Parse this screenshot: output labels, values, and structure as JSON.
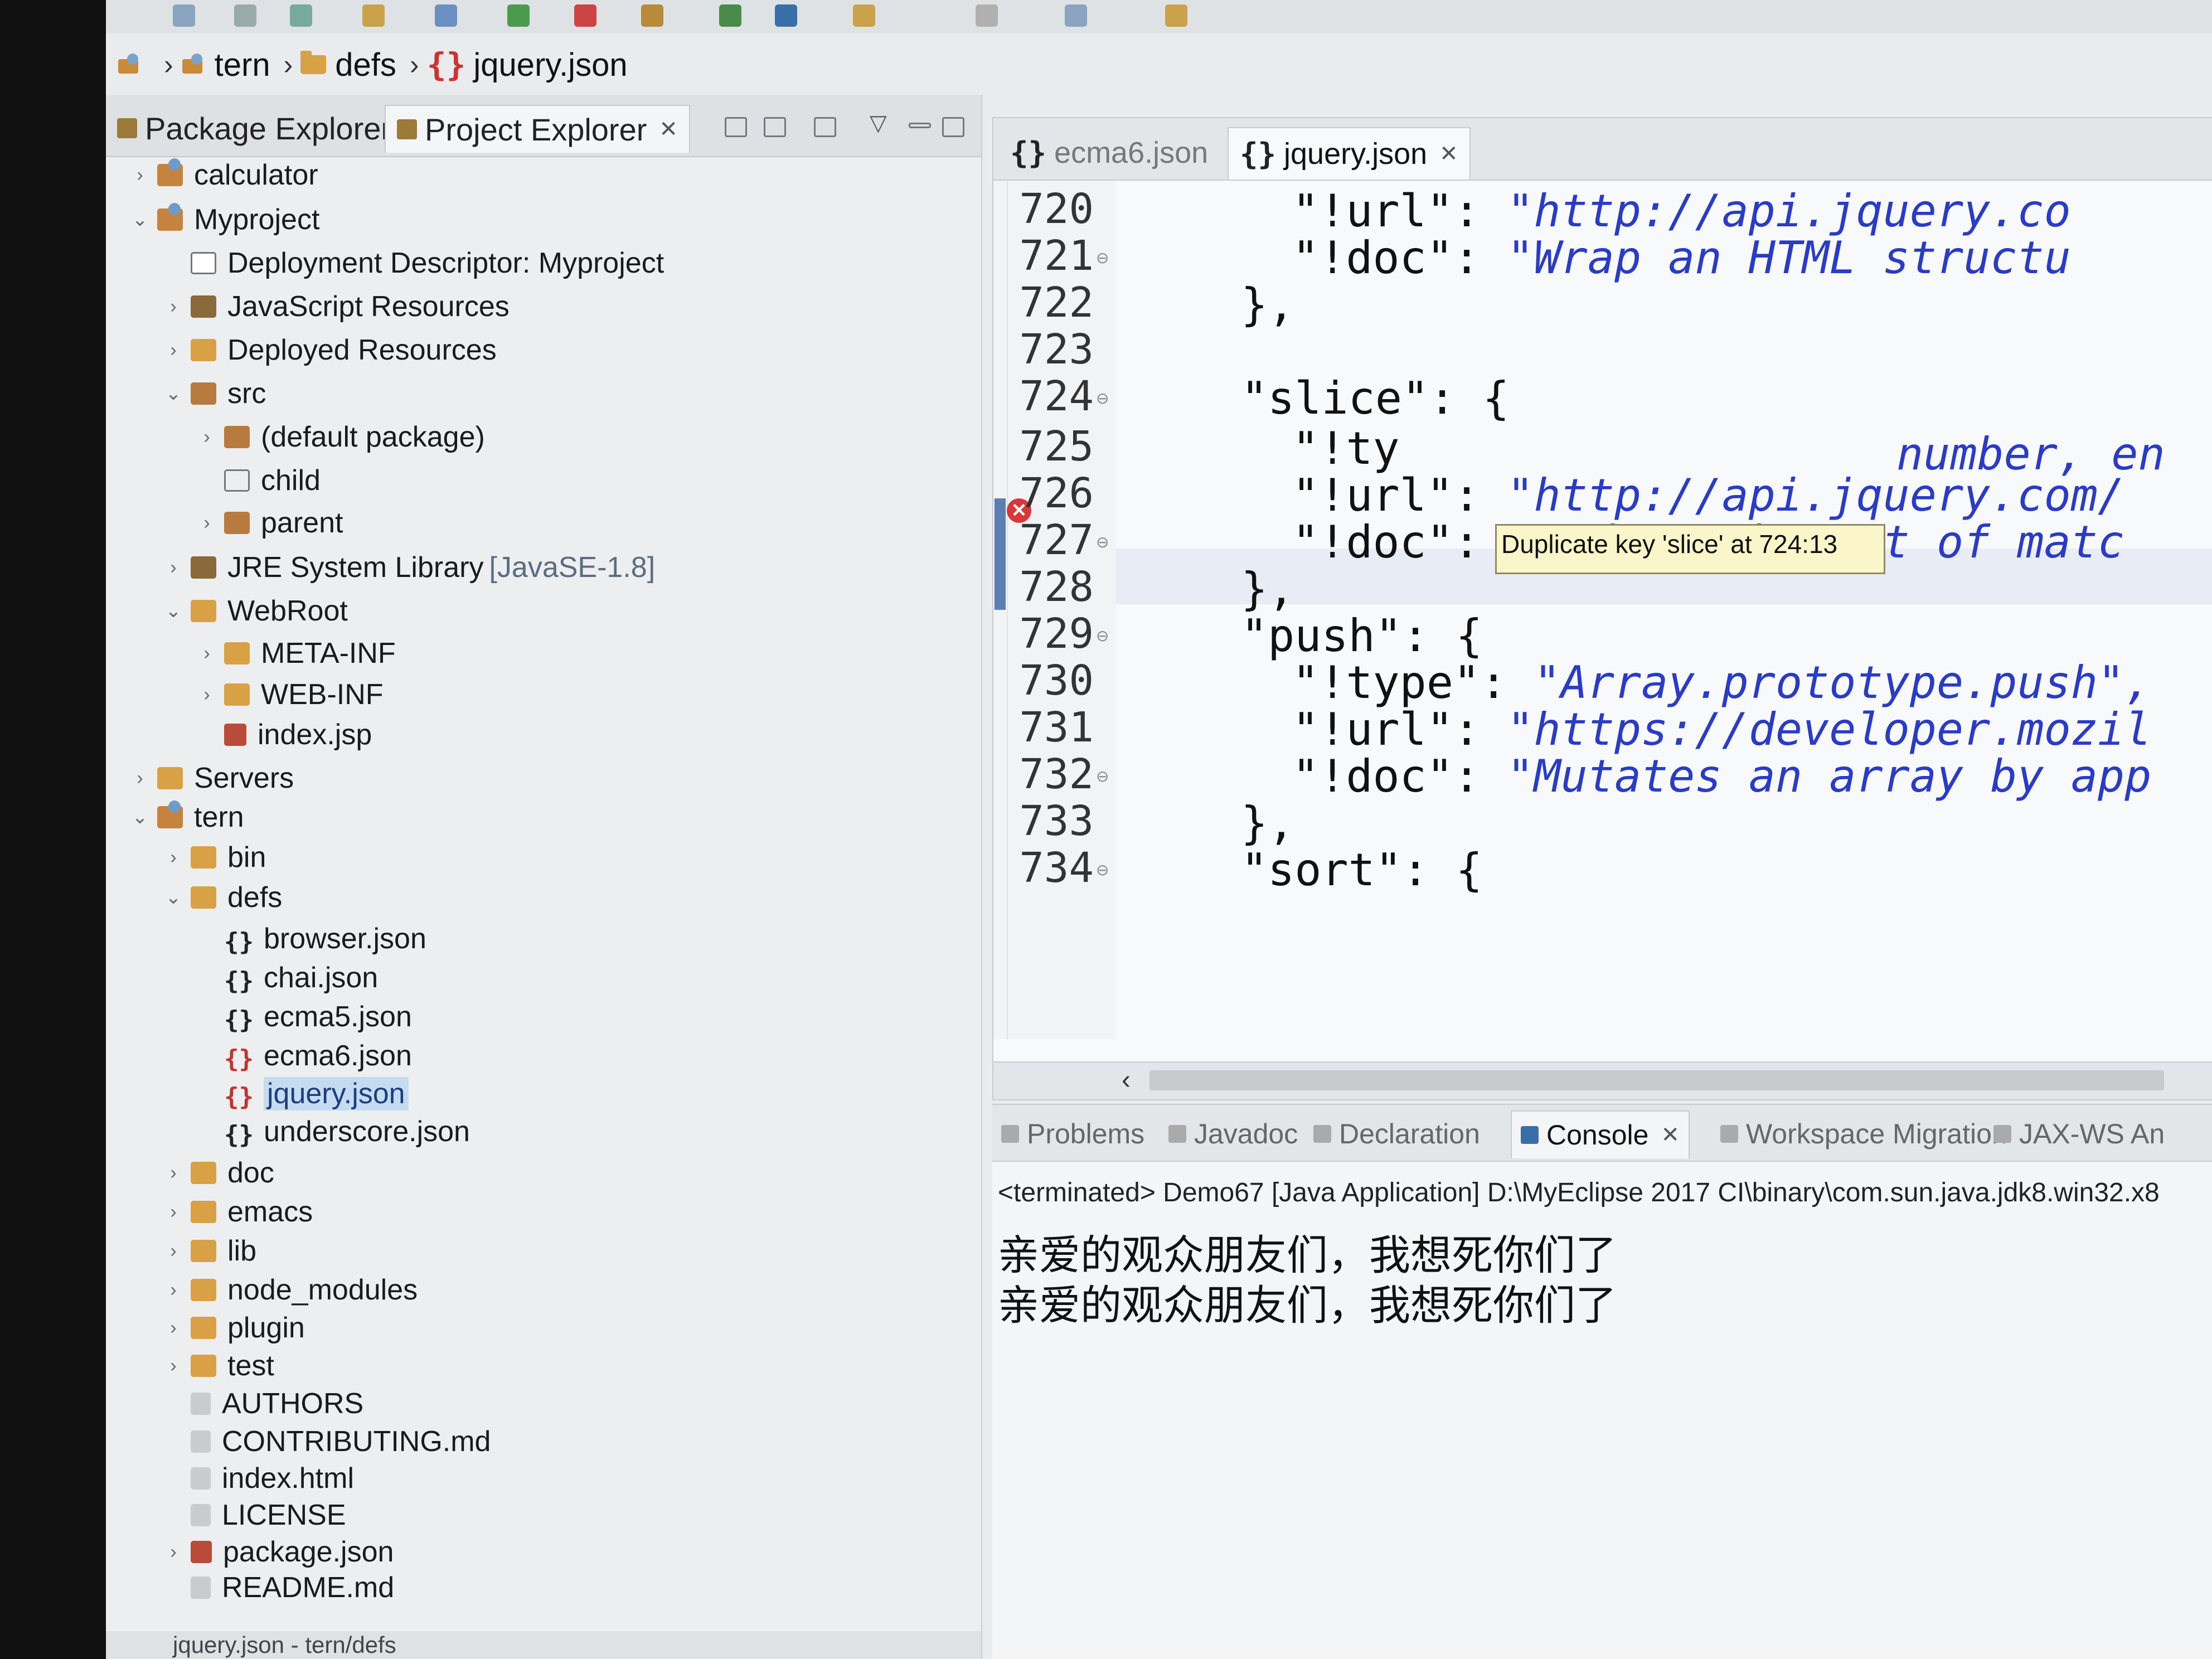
{
  "breadcrumb": [
    "tern",
    "defs",
    "jquery.json"
  ],
  "left_panel": {
    "tabs": [
      {
        "label": "Package Explorer",
        "active": false
      },
      {
        "label": "Project Explorer",
        "active": true
      }
    ],
    "tree": [
      {
        "label": "calculator",
        "depth": 0,
        "twisty": "›",
        "icon": "proj"
      },
      {
        "label": "Myproject",
        "depth": 0,
        "twisty": "⌄",
        "icon": "proj"
      },
      {
        "label": "Deployment Descriptor: Myproject",
        "depth": 1,
        "twisty": "",
        "icon": "dd"
      },
      {
        "label": "JavaScript Resources",
        "depth": 1,
        "twisty": "›",
        "icon": "lib"
      },
      {
        "label": "Deployed Resources",
        "depth": 1,
        "twisty": "›",
        "icon": "folder"
      },
      {
        "label": "src",
        "depth": 1,
        "twisty": "⌄",
        "icon": "pkg"
      },
      {
        "label": "(default package)",
        "depth": 2,
        "twisty": "›",
        "icon": "pkg"
      },
      {
        "label": "child",
        "depth": 2,
        "twisty": "",
        "icon": "pkg-empty"
      },
      {
        "label": "parent",
        "depth": 2,
        "twisty": "›",
        "icon": "pkg"
      },
      {
        "label": "JRE System Library",
        "suffix": "[JavaSE-1.8]",
        "depth": 1,
        "twisty": "›",
        "icon": "lib"
      },
      {
        "label": "WebRoot",
        "depth": 1,
        "twisty": "⌄",
        "icon": "folder"
      },
      {
        "label": "META-INF",
        "depth": 2,
        "twisty": "›",
        "icon": "folder"
      },
      {
        "label": "WEB-INF",
        "depth": 2,
        "twisty": "›",
        "icon": "folder"
      },
      {
        "label": "index.jsp",
        "depth": 2,
        "twisty": "",
        "icon": "jsp"
      },
      {
        "label": "Servers",
        "depth": 0,
        "twisty": "›",
        "icon": "folder"
      },
      {
        "label": "tern",
        "depth": 0,
        "twisty": "⌄",
        "icon": "proj"
      },
      {
        "label": "bin",
        "depth": 1,
        "twisty": "›",
        "icon": "folder"
      },
      {
        "label": "defs",
        "depth": 1,
        "twisty": "⌄",
        "icon": "folder"
      },
      {
        "label": "browser.json",
        "depth": 2,
        "twisty": "",
        "icon": "json"
      },
      {
        "label": "chai.json",
        "depth": 2,
        "twisty": "",
        "icon": "json"
      },
      {
        "label": "ecma5.json",
        "depth": 2,
        "twisty": "",
        "icon": "json"
      },
      {
        "label": "ecma6.json",
        "depth": 2,
        "twisty": "",
        "icon": "json-err"
      },
      {
        "label": "jquery.json",
        "depth": 2,
        "twisty": "",
        "icon": "json-err",
        "selected": true
      },
      {
        "label": "underscore.json",
        "depth": 2,
        "twisty": "",
        "icon": "json"
      },
      {
        "label": "doc",
        "depth": 1,
        "twisty": "›",
        "icon": "folder"
      },
      {
        "label": "emacs",
        "depth": 1,
        "twisty": "›",
        "icon": "folder"
      },
      {
        "label": "lib",
        "depth": 1,
        "twisty": "›",
        "icon": "folder"
      },
      {
        "label": "node_modules",
        "depth": 1,
        "twisty": "›",
        "icon": "folder"
      },
      {
        "label": "plugin",
        "depth": 1,
        "twisty": "›",
        "icon": "folder"
      },
      {
        "label": "test",
        "depth": 1,
        "twisty": "›",
        "icon": "folder"
      },
      {
        "label": "AUTHORS",
        "depth": 1,
        "twisty": "",
        "icon": "file"
      },
      {
        "label": "CONTRIBUTING.md",
        "depth": 1,
        "twisty": "",
        "icon": "file"
      },
      {
        "label": "index.html",
        "depth": 1,
        "twisty": "",
        "icon": "file"
      },
      {
        "label": "LICENSE",
        "depth": 1,
        "twisty": "",
        "icon": "file"
      },
      {
        "label": "package.json",
        "depth": 1,
        "twisty": "›",
        "icon": "pkgjson"
      },
      {
        "label": "README.md",
        "depth": 1,
        "twisty": "",
        "icon": "file"
      }
    ],
    "status": "jquery.json - tern/defs"
  },
  "editor": {
    "tabs": [
      {
        "label": "ecma6.json",
        "active": false
      },
      {
        "label": "jquery.json",
        "active": true
      }
    ],
    "lines": [
      {
        "n": "720",
        "fold": false,
        "indent": 6,
        "parts": [
          [
            "k",
            "\"!url\": "
          ],
          [
            "s",
            "\"http://api.jquery.co"
          ]
        ]
      },
      {
        "n": "721",
        "fold": true,
        "indent": 6,
        "parts": [
          [
            "k",
            "\"!doc\": "
          ],
          [
            "s",
            "\"Wrap an HTML structu"
          ]
        ]
      },
      {
        "n": "722",
        "fold": false,
        "indent": 4,
        "parts": [
          [
            "k",
            "},"
          ]
        ]
      },
      {
        "n": "723",
        "fold": false,
        "indent": 0,
        "parts": []
      },
      {
        "n": "724",
        "fold": true,
        "indent": 4,
        "parts": [
          [
            "k",
            "\"slice\": {"
          ]
        ]
      },
      {
        "n": "725",
        "fold": false,
        "indent": 6,
        "parts": [
          [
            "k",
            "\"!ty"
          ]
        ]
      },
      {
        "n": "726",
        "fold": false,
        "indent": 6,
        "parts": [
          [
            "k",
            "\"!url\": "
          ],
          [
            "s",
            "\"http://api.jquery.com/"
          ]
        ]
      },
      {
        "n": "727",
        "fold": true,
        "indent": 6,
        "parts": [
          [
            "k",
            "\"!doc\": "
          ],
          [
            "s",
            "\"Reduce the set of matc"
          ]
        ]
      },
      {
        "n": "728",
        "fold": false,
        "indent": 4,
        "parts": [
          [
            "k",
            "},"
          ]
        ]
      },
      {
        "n": "729",
        "fold": true,
        "indent": 4,
        "parts": [
          [
            "k",
            "\"push\": {"
          ]
        ]
      },
      {
        "n": "730",
        "fold": false,
        "indent": 6,
        "parts": [
          [
            "k",
            "\"!type\": "
          ],
          [
            "s",
            "\"Array.prototype.push\","
          ]
        ]
      },
      {
        "n": "731",
        "fold": false,
        "indent": 6,
        "parts": [
          [
            "k",
            "\"!url\": "
          ],
          [
            "s",
            "\"https://developer.mozil"
          ]
        ]
      },
      {
        "n": "732",
        "fold": true,
        "indent": 6,
        "parts": [
          [
            "k",
            "\"!doc\": "
          ],
          [
            "s",
            "\"Mutates an array by app"
          ]
        ]
      },
      {
        "n": "733",
        "fold": false,
        "indent": 4,
        "parts": [
          [
            "k",
            "},"
          ]
        ]
      },
      {
        "n": "734",
        "fold": true,
        "indent": 4,
        "parts": [
          [
            "k",
            "\"sort\": {"
          ]
        ]
      }
    ],
    "line725_tail": "number, en",
    "tooltip": "Duplicate key 'slice' at 724:13",
    "error_line": "724"
  },
  "bottom_panel": {
    "tabs": [
      {
        "label": "Problems",
        "active": false
      },
      {
        "label": "Javadoc",
        "active": false
      },
      {
        "label": "Declaration",
        "active": false
      },
      {
        "label": "Console",
        "active": true
      },
      {
        "label": "Workspace Migration",
        "active": false
      },
      {
        "label": "JAX-WS An",
        "active": false
      }
    ],
    "console_header": "<terminated> Demo67 [Java Application] D:\\MyEclipse 2017 CI\\binary\\com.sun.java.jdk8.win32.x8",
    "console_lines": [
      "亲爱的观众朋友们，我想死你们了",
      "亲爱的观众朋友们，我想死你们了"
    ]
  },
  "colors": {
    "string_blue": "#2a3cc7",
    "error_red": "#d9383a",
    "tooltip_bg": "#fbf6c9",
    "selection": "#c5dbf1"
  }
}
